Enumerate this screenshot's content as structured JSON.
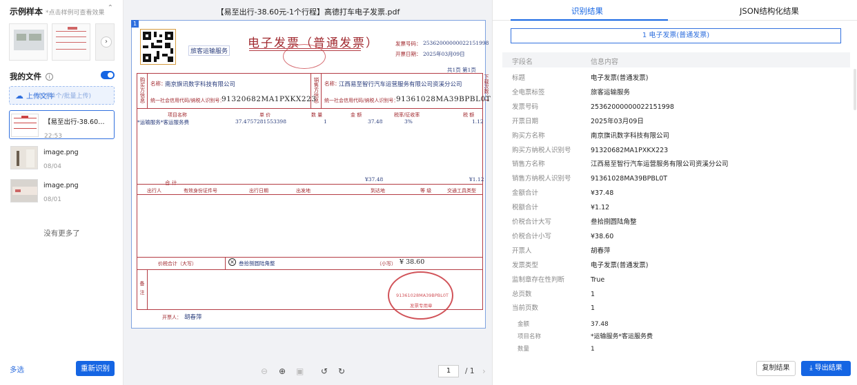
{
  "sidebar": {
    "title": "示例样本",
    "hint": "*点击样例可查看效果",
    "my_files": "我的文件",
    "upload_label": "上传文件",
    "upload_sub": "(支持单个/批量上传)",
    "files": [
      {
        "name": "【易至出行-38.60元-1个行程】高德打车电子发票.pdf",
        "date": "22:53"
      },
      {
        "name": "image.png",
        "date": "08/04"
      },
      {
        "name": "image.png",
        "date": "08/01"
      }
    ],
    "no_more": "没有更多了",
    "multi_select": "多选",
    "rerun": "重新识别"
  },
  "viewer": {
    "title": "【易至出行-38.60元-1个行程】高德打车电子发票.pdf",
    "page_badge": "1",
    "page_current": "1",
    "page_total": "/ 1"
  },
  "invoice": {
    "title": "电子发票（普通发票）",
    "tag": "旅客运输服务",
    "no_label": "发票号码：",
    "no": "25362000000022151998",
    "date_label": "开票日期：",
    "date": "2025年03月09日",
    "page_info": "共1页  第1页",
    "buyer_side": "购买方信息",
    "seller_side": "销售方信息",
    "name_label": "名称：",
    "buyer_name": "南京旗讯数字科技有限公司",
    "seller_name": "江西易至智行汽车运营服务有限公司资溪分公司",
    "tax_label": "统一社会信用代码/纳税人识别号：",
    "buyer_tax": "91320682MA1PXKX223",
    "seller_tax": "91361028MA39BPBL0T",
    "h_item": "项目名称",
    "h_price": "单  价",
    "h_qty": "数  量",
    "h_amount": "金  额",
    "h_rate": "税率/征收率",
    "h_tax": "税  额",
    "item": "*运输服务*客运服务费",
    "price": "37.4757281553398",
    "qty": "1",
    "amount": "37.48",
    "rate": "3%",
    "tax": "1.12",
    "total_label": "合      计",
    "total_amount": "¥37.48",
    "total_tax": "¥1.12",
    "t_person": "出行人",
    "t_id": "有效身份证件号",
    "t_date": "出行日期",
    "t_from": "出发地",
    "t_to": "到达地",
    "t_class": "等  级",
    "t_vehicle": "交通工具类型",
    "sum_label": "价税合计（大写）",
    "sum_upper": "叁拾捌圆陆角整",
    "sum_small_label": "（小写）",
    "sum_small": "¥ 38.60",
    "remark_label": "备注",
    "drawer_label": "开票人：",
    "drawer": "胡春萍",
    "stamp_text": "91361028MA39BPBL0T",
    "stamp_sub": "发票专用章",
    "side_note": "下载次数：1"
  },
  "results": {
    "tab_result": "识别结果",
    "tab_json": "JSON结构化结果",
    "doc_type": "1 电子发票(普通发票)",
    "col_field": "字段名",
    "col_value": "信息内容",
    "rows": [
      {
        "k": "标题",
        "v": "电子发票(普通发票)"
      },
      {
        "k": "全电票标签",
        "v": "旅客运输服务"
      },
      {
        "k": "发票号码",
        "v": "25362000000022151998"
      },
      {
        "k": "开票日期",
        "v": "2025年03月09日"
      },
      {
        "k": "购买方名称",
        "v": "南京旗讯数字科技有限公司"
      },
      {
        "k": "购买方纳税人识别号",
        "v": "91320682MA1PXKX223"
      },
      {
        "k": "销售方名称",
        "v": "江西易至智行汽车运营服务有限公司资溪分公司"
      },
      {
        "k": "销售方纳税人识别号",
        "v": "91361028MA39BPBL0T"
      },
      {
        "k": "金额合计",
        "v": "¥37.48"
      },
      {
        "k": "税额合计",
        "v": "¥1.12"
      },
      {
        "k": "价税合计大写",
        "v": "叁拾捌圆陆角整"
      },
      {
        "k": "价税合计小写",
        "v": "¥38.60"
      },
      {
        "k": "开票人",
        "v": "胡春萍"
      },
      {
        "k": "发票类型",
        "v": "电子发票(普通发票)"
      },
      {
        "k": "监制章存在性判断",
        "v": "True"
      },
      {
        "k": "总页数",
        "v": "1"
      },
      {
        "k": "当前页数",
        "v": "1"
      }
    ],
    "sub_rows": [
      {
        "k": "金额",
        "v": "37.48"
      },
      {
        "k": "项目名称",
        "v": "*运输服务*客运服务费"
      },
      {
        "k": "数量",
        "v": "1"
      }
    ],
    "copy": "复制结果",
    "export": "导出结果"
  }
}
